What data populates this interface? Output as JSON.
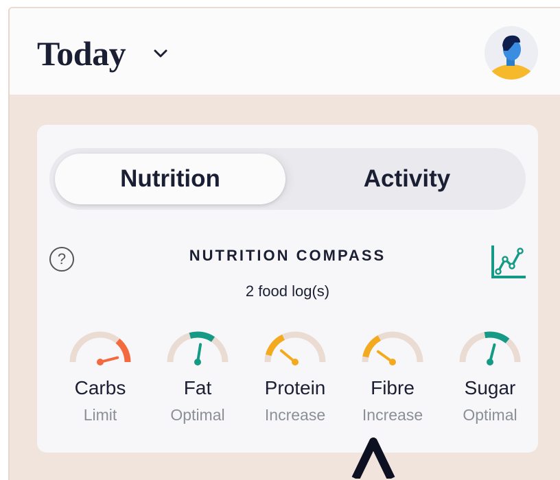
{
  "header": {
    "title": "Today",
    "dropdown_icon": "chevron-down-icon",
    "avatar_icon": "user-avatar-icon"
  },
  "tabs": [
    {
      "label": "Nutrition",
      "active": true
    },
    {
      "label": "Activity",
      "active": false
    }
  ],
  "compass": {
    "help_symbol": "?",
    "title": "NUTRITION COMPASS",
    "subtitle": "2 food log(s)",
    "chart_icon": "trend-chart-icon"
  },
  "gauges": [
    {
      "name": "Carbs",
      "status": "Limit",
      "level": 0.92,
      "color": "#f26a3d"
    },
    {
      "name": "Fat",
      "status": "Optimal",
      "level": 0.55,
      "color": "#159a86"
    },
    {
      "name": "Protein",
      "status": "Increase",
      "level": 0.22,
      "color": "#f4aa1f"
    },
    {
      "name": "Fibre",
      "status": "Increase",
      "level": 0.2,
      "color": "#f4aa1f"
    },
    {
      "name": "Sugar",
      "status": "Optimal",
      "level": 0.58,
      "color": "#159a86"
    }
  ],
  "colors": {
    "page_background": "#f1e4dc",
    "card_background": "#f7f7f9",
    "text_primary": "#1b1f33",
    "text_secondary": "#8b8f96",
    "accent_green": "#159a86",
    "gauge_track": "#eadbd3"
  }
}
